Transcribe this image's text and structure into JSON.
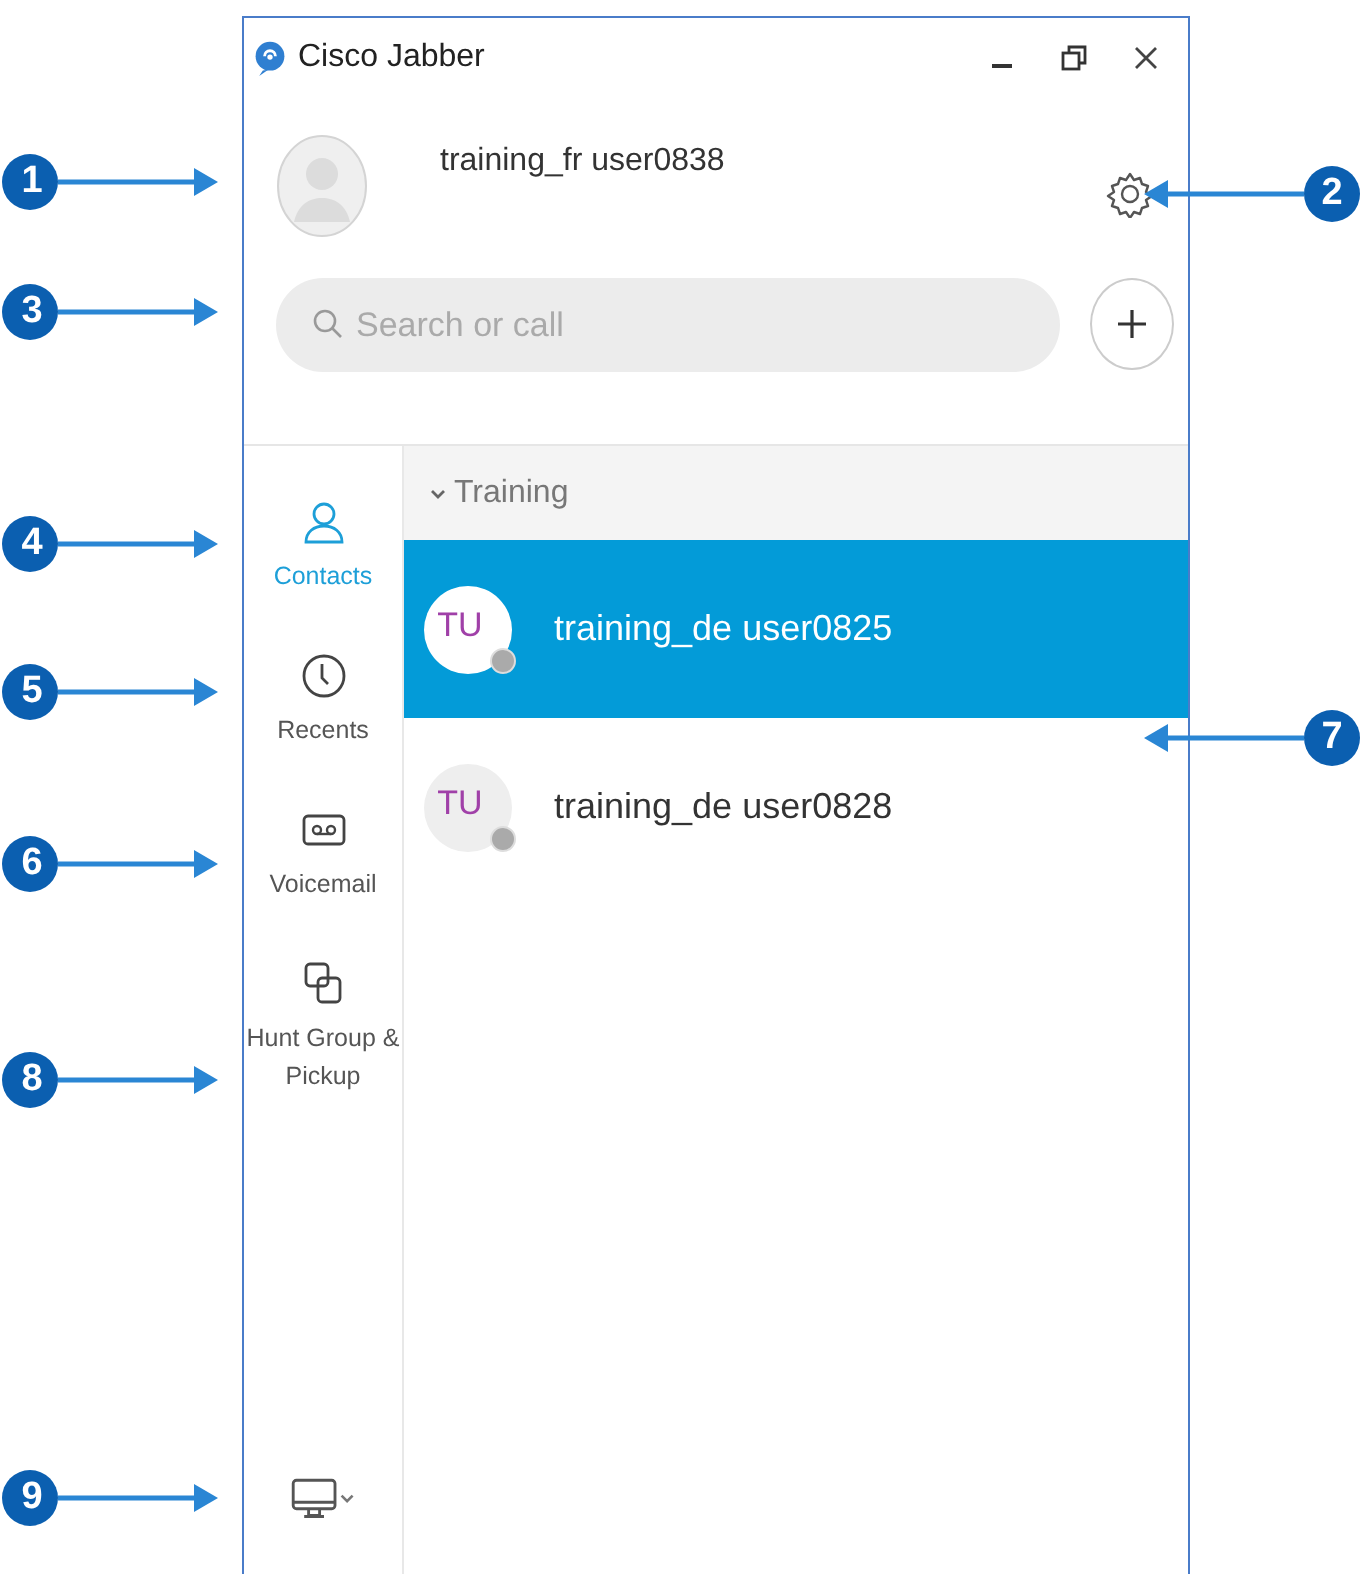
{
  "window": {
    "title": "Cisco Jabber"
  },
  "user": {
    "name": "training_fr user0838"
  },
  "search": {
    "placeholder": "Search or call"
  },
  "sidebar": {
    "items": [
      {
        "label": "Contacts",
        "kind": "contacts",
        "selected": true
      },
      {
        "label": "Recents",
        "kind": "recents",
        "selected": false
      },
      {
        "label": "Voicemail",
        "kind": "voicemail",
        "selected": false
      },
      {
        "label": "Hunt Group & Pickup",
        "kind": "hunt",
        "selected": false
      }
    ]
  },
  "contacts": {
    "group": {
      "label": "Training",
      "expanded": true
    },
    "items": [
      {
        "initials": "TU",
        "name": "training_de user0825",
        "selected": true
      },
      {
        "initials": "TU",
        "name": "training_de user0828",
        "selected": false
      }
    ]
  },
  "left_callouts": [
    "1",
    "3",
    "4",
    "5",
    "6",
    "8",
    "9"
  ],
  "right_callouts": [
    "2",
    "7"
  ]
}
